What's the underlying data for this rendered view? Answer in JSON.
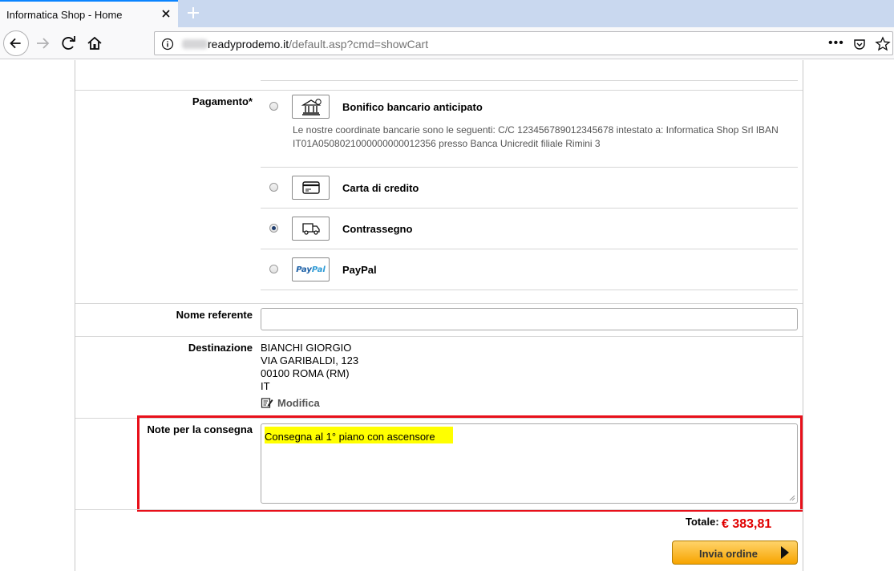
{
  "browser": {
    "tab_title": "Informatica Shop - Home",
    "url_domain": "readyprodemo.it",
    "url_path": "/default.asp?cmd=showCart",
    "more_label": "•••"
  },
  "payment": {
    "label": "Pagamento*",
    "options": [
      {
        "name": "Bonifico bancario anticipato",
        "icon": "bank-icon",
        "selected": false,
        "description": "Le nostre coordinate bancarie sono le seguenti: C/C 123456789012345678 intestato a: Informatica Shop Srl IBAN IT01A0508021000000000012356 presso Banca Unicredit filiale Rimini 3"
      },
      {
        "name": "Carta di credito",
        "icon": "credit-card-icon",
        "selected": false
      },
      {
        "name": "Contrassegno",
        "icon": "delivery-truck-icon",
        "selected": true
      },
      {
        "name": "PayPal",
        "icon": "paypal-logo",
        "selected": false
      }
    ]
  },
  "nome_referente": {
    "label": "Nome referente",
    "value": ""
  },
  "destinazione": {
    "label": "Destinazione",
    "lines": [
      "BIANCHI GIORGIO",
      "VIA GARIBALDI, 123",
      "00100 ROMA (RM)",
      "IT"
    ],
    "edit_label": "Modifica"
  },
  "note": {
    "label": "Note per la consegna",
    "value": "Consegna al 1° piano con ascensore"
  },
  "totals": {
    "label": "Totale:",
    "value": "€ 383,81"
  },
  "order_button": {
    "label": "Invia ordine"
  },
  "colors": {
    "accent": "#e8101a",
    "total": "#e00000",
    "button": "#f7a400",
    "note_highlight": "#ffff00"
  }
}
